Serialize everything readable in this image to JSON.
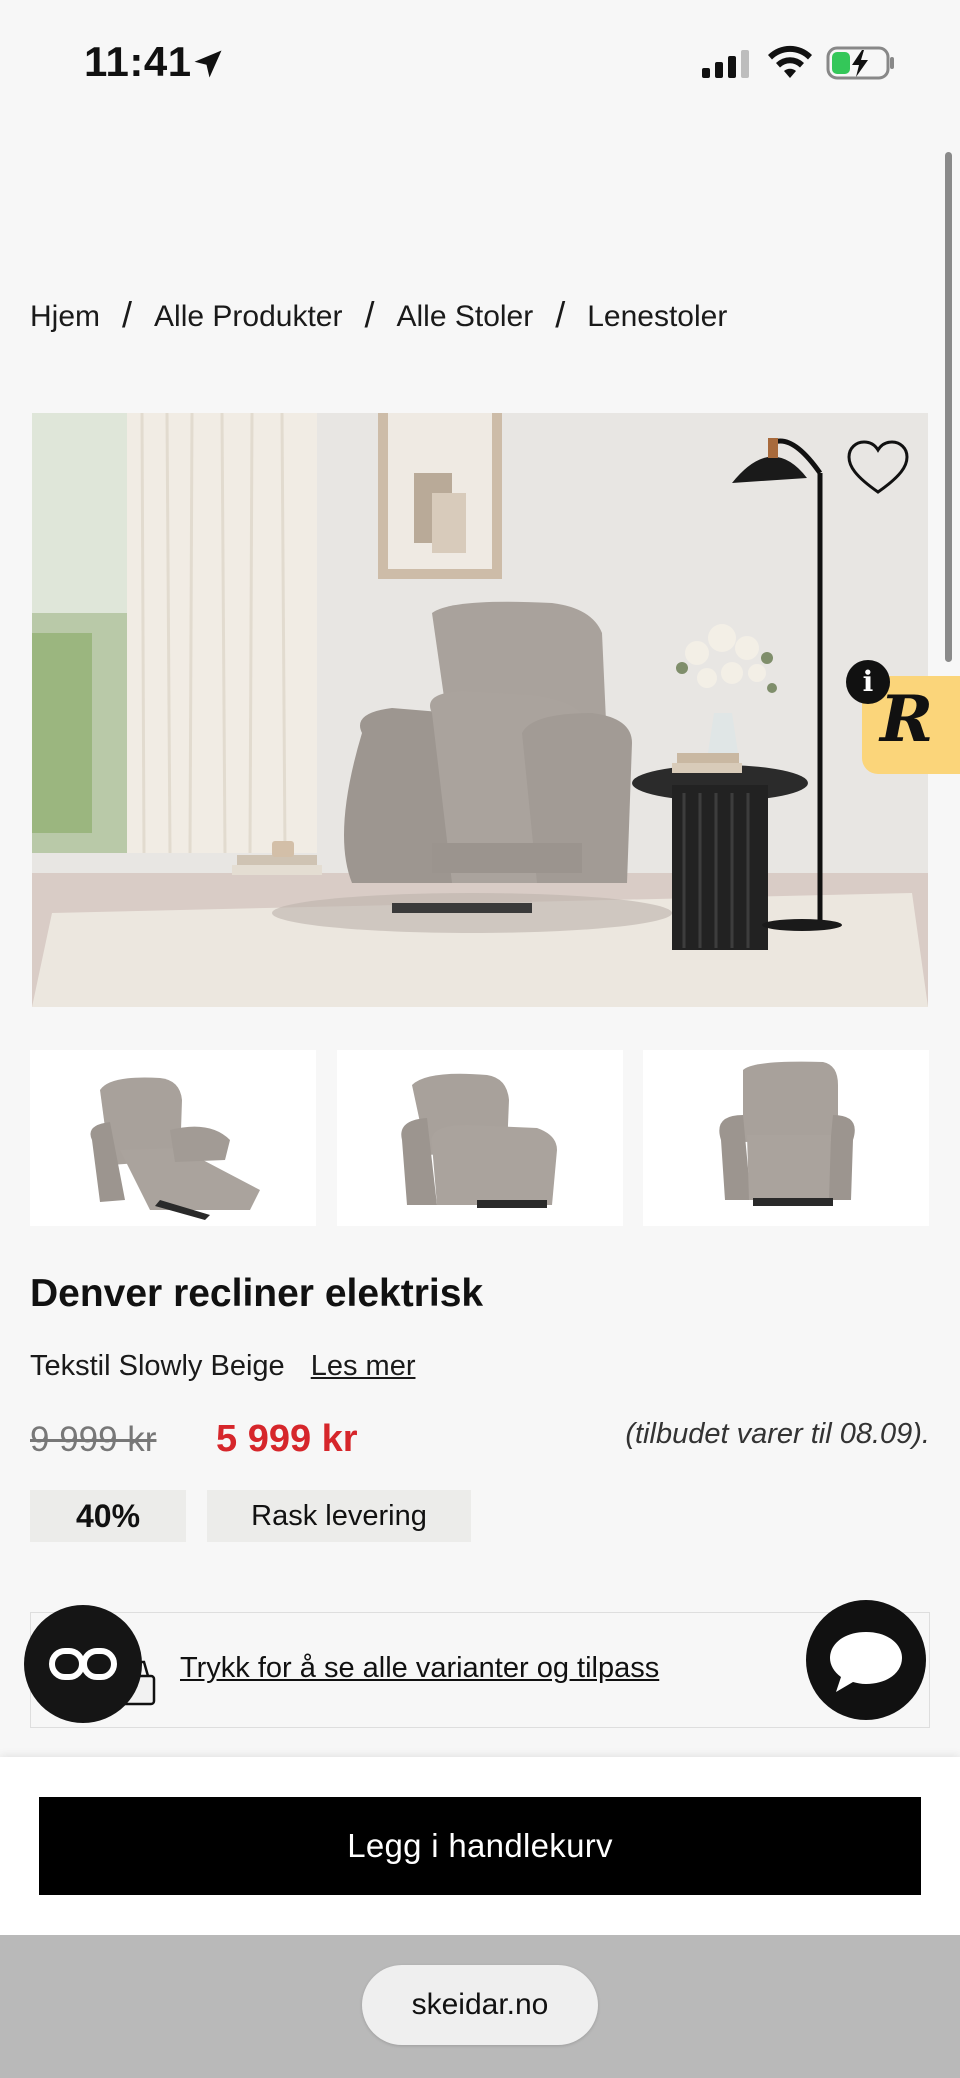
{
  "status_bar": {
    "time": "11:41"
  },
  "breadcrumb": {
    "items": [
      "Hjem",
      "Alle Produkter",
      "Alle Stoler",
      "Lenestoler"
    ],
    "separator": "/"
  },
  "gallery": {
    "main_image_icon": "recliner-chair-photo",
    "thumbnail_count": 3
  },
  "widget": {
    "info_label": "i",
    "badge_letter": "R",
    "badge_color": "#fbd57a"
  },
  "product": {
    "title": "Denver recliner elektrisk",
    "variant": "Tekstil Slowly Beige",
    "read_more": "Les mer",
    "old_price": "9 999 kr",
    "new_price": "5 999 kr",
    "offer_note": "(tilbudet varer til 08.09).",
    "discount_badge": "40%",
    "delivery_badge": "Rask levering",
    "variants_link": "Trykk for å se alle varianter og tilpass"
  },
  "colors": {
    "price_red": "#d6262b",
    "button_black": "#000000",
    "battery_green": "#34c759"
  },
  "cta": {
    "add_to_cart": "Legg i handlekurv"
  },
  "browser": {
    "url": "skeidar.no"
  }
}
